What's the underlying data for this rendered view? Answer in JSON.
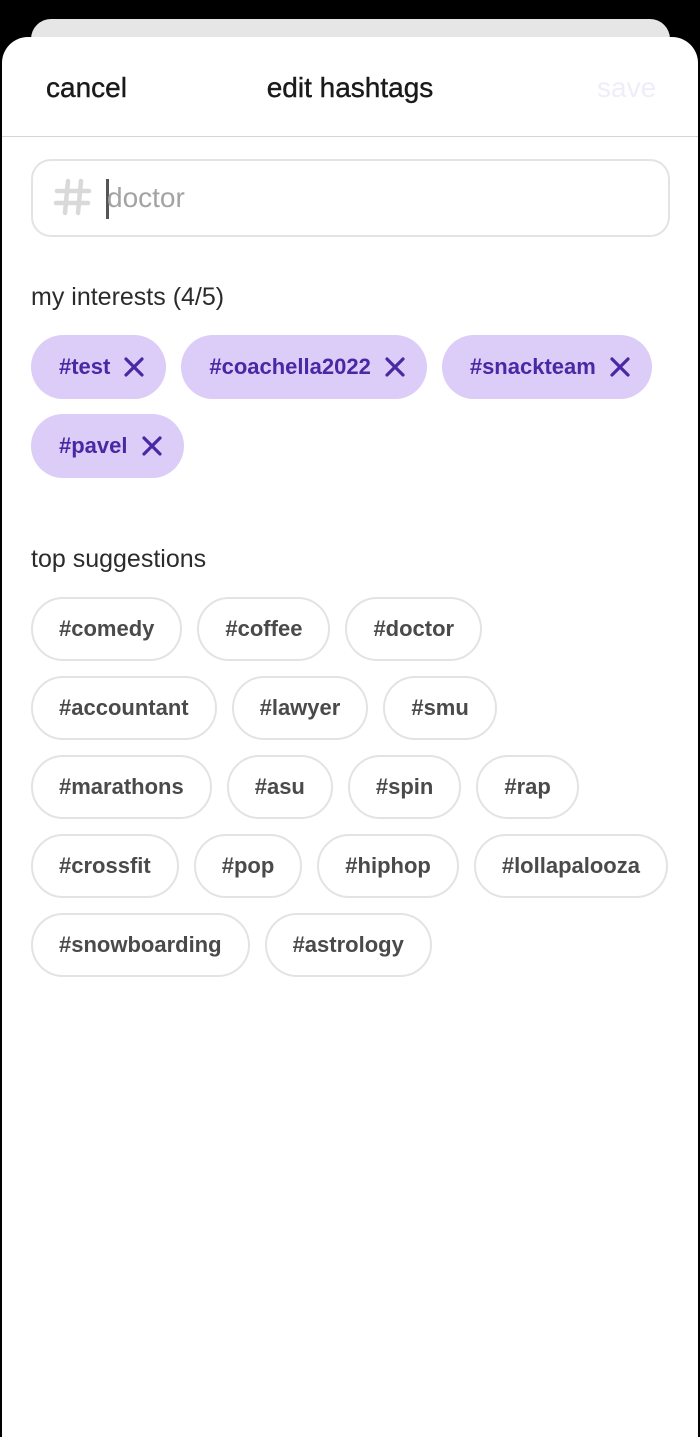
{
  "header": {
    "cancel_label": "cancel",
    "title": "edit hashtags",
    "save_label": "save"
  },
  "search": {
    "placeholder": "doctor",
    "icon": "hash-icon"
  },
  "interests": {
    "label": "my interests (4/5)",
    "items": [
      "#test",
      "#coachella2022",
      "#snackteam",
      "#pavel"
    ]
  },
  "suggestions": {
    "label": "top suggestions",
    "items": [
      "#comedy",
      "#coffee",
      "#doctor",
      "#accountant",
      "#lawyer",
      "#smu",
      "#marathons",
      "#asu",
      "#spin",
      "#rap",
      "#crossfit",
      "#pop",
      "#hiphop",
      "#lollapalooza",
      "#snowboarding",
      "#astrology"
    ]
  },
  "colors": {
    "accent": "#4a28a3",
    "selected_chip_bg": "#dcccf8",
    "save_disabled": "#efedf9"
  }
}
